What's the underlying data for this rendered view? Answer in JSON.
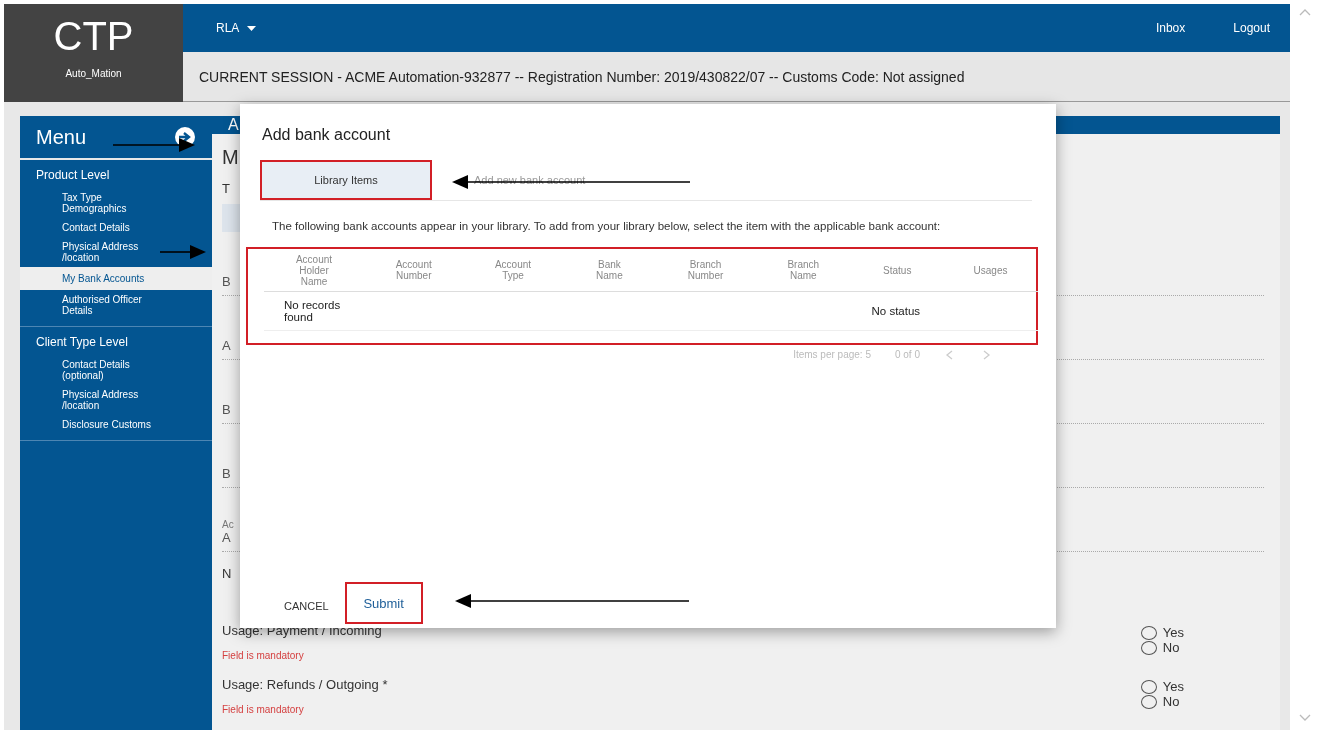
{
  "brand": {
    "logo": "CTP",
    "user": "Auto_Mation"
  },
  "top_nav": {
    "menu": "RLA",
    "links": [
      "Inbox",
      "Logout"
    ]
  },
  "session_bar": "CURRENT SESSION - ACME Automation-932877 -- Registration Number: 2019/430822/07 -- Customs Code: Not assigned",
  "sidebar": {
    "title": "Menu",
    "sections": [
      {
        "heading": "Product Level",
        "items": [
          {
            "label": "Tax Type Demographics",
            "selected": false
          },
          {
            "label": "Contact Details",
            "selected": false
          },
          {
            "label": "Physical Address /location",
            "selected": false
          },
          {
            "label": "My Bank Accounts",
            "selected": true
          },
          {
            "label": "Authorised Officer Details",
            "selected": false
          }
        ]
      },
      {
        "heading": "Client Type Level",
        "items": [
          {
            "label": "Contact Details (optional)",
            "selected": false
          },
          {
            "label": "Physical Address /location",
            "selected": false
          },
          {
            "label": "Disclosure Customs",
            "selected": false
          }
        ]
      }
    ]
  },
  "main": {
    "header": "A",
    "title": "M",
    "subtitle": "T",
    "fields": [
      {
        "kind": "line",
        "label": "B"
      },
      {
        "kind": "line",
        "label": "A"
      },
      {
        "kind": "line",
        "label": "B"
      },
      {
        "kind": "line",
        "label": "B"
      },
      {
        "kind": "double",
        "caption": "Ac",
        "label": "A"
      }
    ],
    "section": "N",
    "questions": [
      {
        "label": "Usage: Payment / Incoming",
        "error": "Field is mandatory",
        "options": [
          {
            "label": "Yes",
            "checked": false
          },
          {
            "label": "No",
            "checked": false
          }
        ]
      },
      {
        "label": "Usage: Refunds / Outgoing *",
        "error": "Field is mandatory",
        "options": [
          {
            "label": "Yes",
            "checked": false
          },
          {
            "label": "No",
            "checked": false
          }
        ]
      }
    ]
  },
  "dialog": {
    "title": "Add bank account",
    "tabs": [
      {
        "label": "Library Items",
        "selected": true
      },
      {
        "label": "Add new bank account",
        "selected": false
      }
    ],
    "intro": "The following bank accounts appear in your library. To add from your library below, select the item with the applicable bank account:",
    "table": {
      "columns": [
        "Account Holder Name",
        "Account Number",
        "Account Type",
        "Bank Name",
        "Branch Number",
        "Branch Name",
        "Status",
        "Usages"
      ],
      "rows": [
        [
          "No records found",
          "",
          "",
          "",
          "",
          "",
          "No status",
          ""
        ]
      ]
    },
    "pagination": {
      "items_per_page": "Items per page: 5",
      "range": "0 of 0"
    },
    "buttons": [
      "CANCEL",
      "Submit"
    ]
  }
}
